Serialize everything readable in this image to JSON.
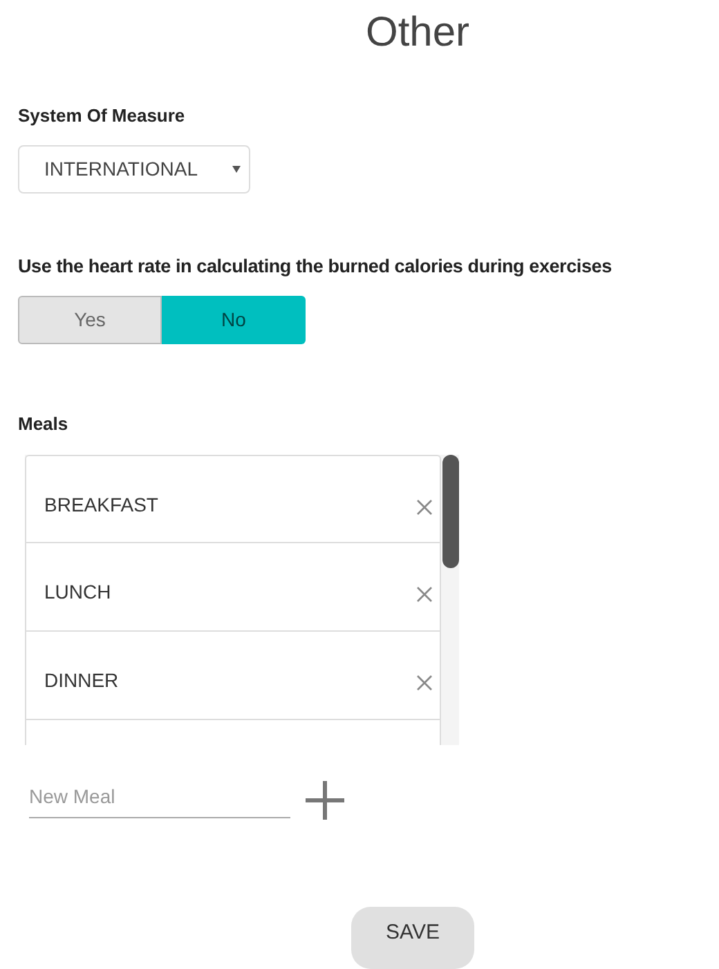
{
  "title": "Other",
  "system_of_measure": {
    "label": "System Of Measure",
    "value": "INTERNATIONAL"
  },
  "heart_rate": {
    "label": "Use the heart rate in calculating the burned calories during exercises",
    "options": [
      {
        "label": "Yes",
        "selected": false
      },
      {
        "label": "No",
        "selected": true
      }
    ]
  },
  "meals": {
    "label": "Meals",
    "items": [
      {
        "name": "BREAKFAST"
      },
      {
        "name": "LUNCH"
      },
      {
        "name": "DINNER"
      }
    ],
    "new_meal": {
      "placeholder": "New Meal"
    }
  },
  "save_button": "SAVE"
}
